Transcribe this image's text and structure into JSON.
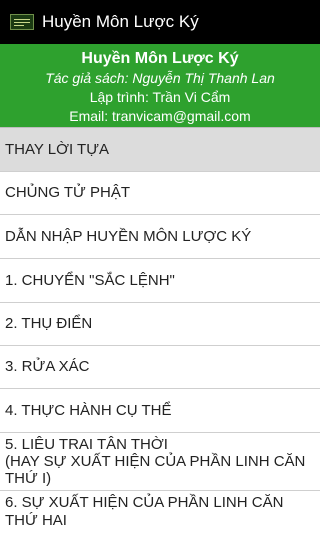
{
  "actionbar": {
    "title": "Huyền Môn Lược Ký",
    "icon": "app-book-icon"
  },
  "header": {
    "title": "Huyền Môn Lược Ký",
    "author": "Tác giả sách: Nguyễn Thị Thanh Lan",
    "developer": "Lập trình: Trần Vi Cẩm",
    "email": "Email: tranvicam@gmail.com"
  },
  "colors": {
    "actionbar_bg": "#000000",
    "header_bg": "#2ea12e",
    "selected_item_bg": "#dcdcdc"
  },
  "items": [
    "THAY LỜI TỰA",
    "CHỦNG TỬ PHẬT",
    "DẪN NHẬP HUYỀN MÔN LƯỢC KÝ",
    "1. CHUYỂN \"SẮC LỆNH\"",
    "2. THỤ ĐIỂN",
    "3. RỬA XÁC",
    "4. THỰC HÀNH CỤ THỂ",
    "5. LIÊU TRAI TÂN THỜI\n(HAY SỰ XUẤT HIỆN CỦA PHẦN LINH CĂN THỨ I)",
    "6. SỰ XUẤT HIỆN CỦA PHẦN LINH CĂN THỨ HAI"
  ]
}
